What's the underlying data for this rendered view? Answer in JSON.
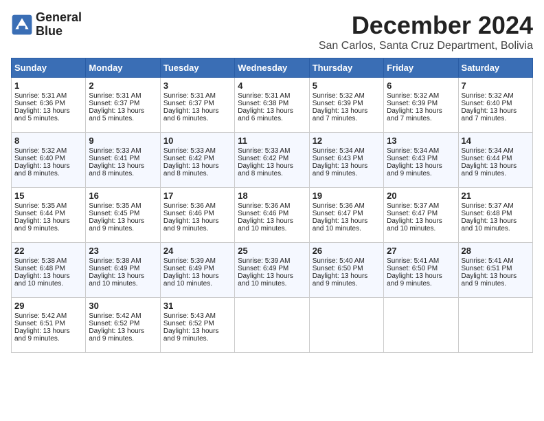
{
  "header": {
    "logo_line1": "General",
    "logo_line2": "Blue",
    "month_title": "December 2024",
    "subtitle": "San Carlos, Santa Cruz Department, Bolivia"
  },
  "calendar": {
    "days_of_week": [
      "Sunday",
      "Monday",
      "Tuesday",
      "Wednesday",
      "Thursday",
      "Friday",
      "Saturday"
    ],
    "weeks": [
      [
        {
          "day": "1",
          "lines": [
            "Sunrise: 5:31 AM",
            "Sunset: 6:36 PM",
            "Daylight: 13 hours",
            "and 5 minutes."
          ]
        },
        {
          "day": "2",
          "lines": [
            "Sunrise: 5:31 AM",
            "Sunset: 6:37 PM",
            "Daylight: 13 hours",
            "and 5 minutes."
          ]
        },
        {
          "day": "3",
          "lines": [
            "Sunrise: 5:31 AM",
            "Sunset: 6:37 PM",
            "Daylight: 13 hours",
            "and 6 minutes."
          ]
        },
        {
          "day": "4",
          "lines": [
            "Sunrise: 5:31 AM",
            "Sunset: 6:38 PM",
            "Daylight: 13 hours",
            "and 6 minutes."
          ]
        },
        {
          "day": "5",
          "lines": [
            "Sunrise: 5:32 AM",
            "Sunset: 6:39 PM",
            "Daylight: 13 hours",
            "and 7 minutes."
          ]
        },
        {
          "day": "6",
          "lines": [
            "Sunrise: 5:32 AM",
            "Sunset: 6:39 PM",
            "Daylight: 13 hours",
            "and 7 minutes."
          ]
        },
        {
          "day": "7",
          "lines": [
            "Sunrise: 5:32 AM",
            "Sunset: 6:40 PM",
            "Daylight: 13 hours",
            "and 7 minutes."
          ]
        }
      ],
      [
        {
          "day": "8",
          "lines": [
            "Sunrise: 5:32 AM",
            "Sunset: 6:40 PM",
            "Daylight: 13 hours",
            "and 8 minutes."
          ]
        },
        {
          "day": "9",
          "lines": [
            "Sunrise: 5:33 AM",
            "Sunset: 6:41 PM",
            "Daylight: 13 hours",
            "and 8 minutes."
          ]
        },
        {
          "day": "10",
          "lines": [
            "Sunrise: 5:33 AM",
            "Sunset: 6:42 PM",
            "Daylight: 13 hours",
            "and 8 minutes."
          ]
        },
        {
          "day": "11",
          "lines": [
            "Sunrise: 5:33 AM",
            "Sunset: 6:42 PM",
            "Daylight: 13 hours",
            "and 8 minutes."
          ]
        },
        {
          "day": "12",
          "lines": [
            "Sunrise: 5:34 AM",
            "Sunset: 6:43 PM",
            "Daylight: 13 hours",
            "and 9 minutes."
          ]
        },
        {
          "day": "13",
          "lines": [
            "Sunrise: 5:34 AM",
            "Sunset: 6:43 PM",
            "Daylight: 13 hours",
            "and 9 minutes."
          ]
        },
        {
          "day": "14",
          "lines": [
            "Sunrise: 5:34 AM",
            "Sunset: 6:44 PM",
            "Daylight: 13 hours",
            "and 9 minutes."
          ]
        }
      ],
      [
        {
          "day": "15",
          "lines": [
            "Sunrise: 5:35 AM",
            "Sunset: 6:44 PM",
            "Daylight: 13 hours",
            "and 9 minutes."
          ]
        },
        {
          "day": "16",
          "lines": [
            "Sunrise: 5:35 AM",
            "Sunset: 6:45 PM",
            "Daylight: 13 hours",
            "and 9 minutes."
          ]
        },
        {
          "day": "17",
          "lines": [
            "Sunrise: 5:36 AM",
            "Sunset: 6:46 PM",
            "Daylight: 13 hours",
            "and 9 minutes."
          ]
        },
        {
          "day": "18",
          "lines": [
            "Sunrise: 5:36 AM",
            "Sunset: 6:46 PM",
            "Daylight: 13 hours",
            "and 10 minutes."
          ]
        },
        {
          "day": "19",
          "lines": [
            "Sunrise: 5:36 AM",
            "Sunset: 6:47 PM",
            "Daylight: 13 hours",
            "and 10 minutes."
          ]
        },
        {
          "day": "20",
          "lines": [
            "Sunrise: 5:37 AM",
            "Sunset: 6:47 PM",
            "Daylight: 13 hours",
            "and 10 minutes."
          ]
        },
        {
          "day": "21",
          "lines": [
            "Sunrise: 5:37 AM",
            "Sunset: 6:48 PM",
            "Daylight: 13 hours",
            "and 10 minutes."
          ]
        }
      ],
      [
        {
          "day": "22",
          "lines": [
            "Sunrise: 5:38 AM",
            "Sunset: 6:48 PM",
            "Daylight: 13 hours",
            "and 10 minutes."
          ]
        },
        {
          "day": "23",
          "lines": [
            "Sunrise: 5:38 AM",
            "Sunset: 6:49 PM",
            "Daylight: 13 hours",
            "and 10 minutes."
          ]
        },
        {
          "day": "24",
          "lines": [
            "Sunrise: 5:39 AM",
            "Sunset: 6:49 PM",
            "Daylight: 13 hours",
            "and 10 minutes."
          ]
        },
        {
          "day": "25",
          "lines": [
            "Sunrise: 5:39 AM",
            "Sunset: 6:49 PM",
            "Daylight: 13 hours",
            "and 10 minutes."
          ]
        },
        {
          "day": "26",
          "lines": [
            "Sunrise: 5:40 AM",
            "Sunset: 6:50 PM",
            "Daylight: 13 hours",
            "and 9 minutes."
          ]
        },
        {
          "day": "27",
          "lines": [
            "Sunrise: 5:41 AM",
            "Sunset: 6:50 PM",
            "Daylight: 13 hours",
            "and 9 minutes."
          ]
        },
        {
          "day": "28",
          "lines": [
            "Sunrise: 5:41 AM",
            "Sunset: 6:51 PM",
            "Daylight: 13 hours",
            "and 9 minutes."
          ]
        }
      ],
      [
        {
          "day": "29",
          "lines": [
            "Sunrise: 5:42 AM",
            "Sunset: 6:51 PM",
            "Daylight: 13 hours",
            "and 9 minutes."
          ]
        },
        {
          "day": "30",
          "lines": [
            "Sunrise: 5:42 AM",
            "Sunset: 6:52 PM",
            "Daylight: 13 hours",
            "and 9 minutes."
          ]
        },
        {
          "day": "31",
          "lines": [
            "Sunrise: 5:43 AM",
            "Sunset: 6:52 PM",
            "Daylight: 13 hours",
            "and 9 minutes."
          ]
        },
        null,
        null,
        null,
        null
      ]
    ]
  }
}
